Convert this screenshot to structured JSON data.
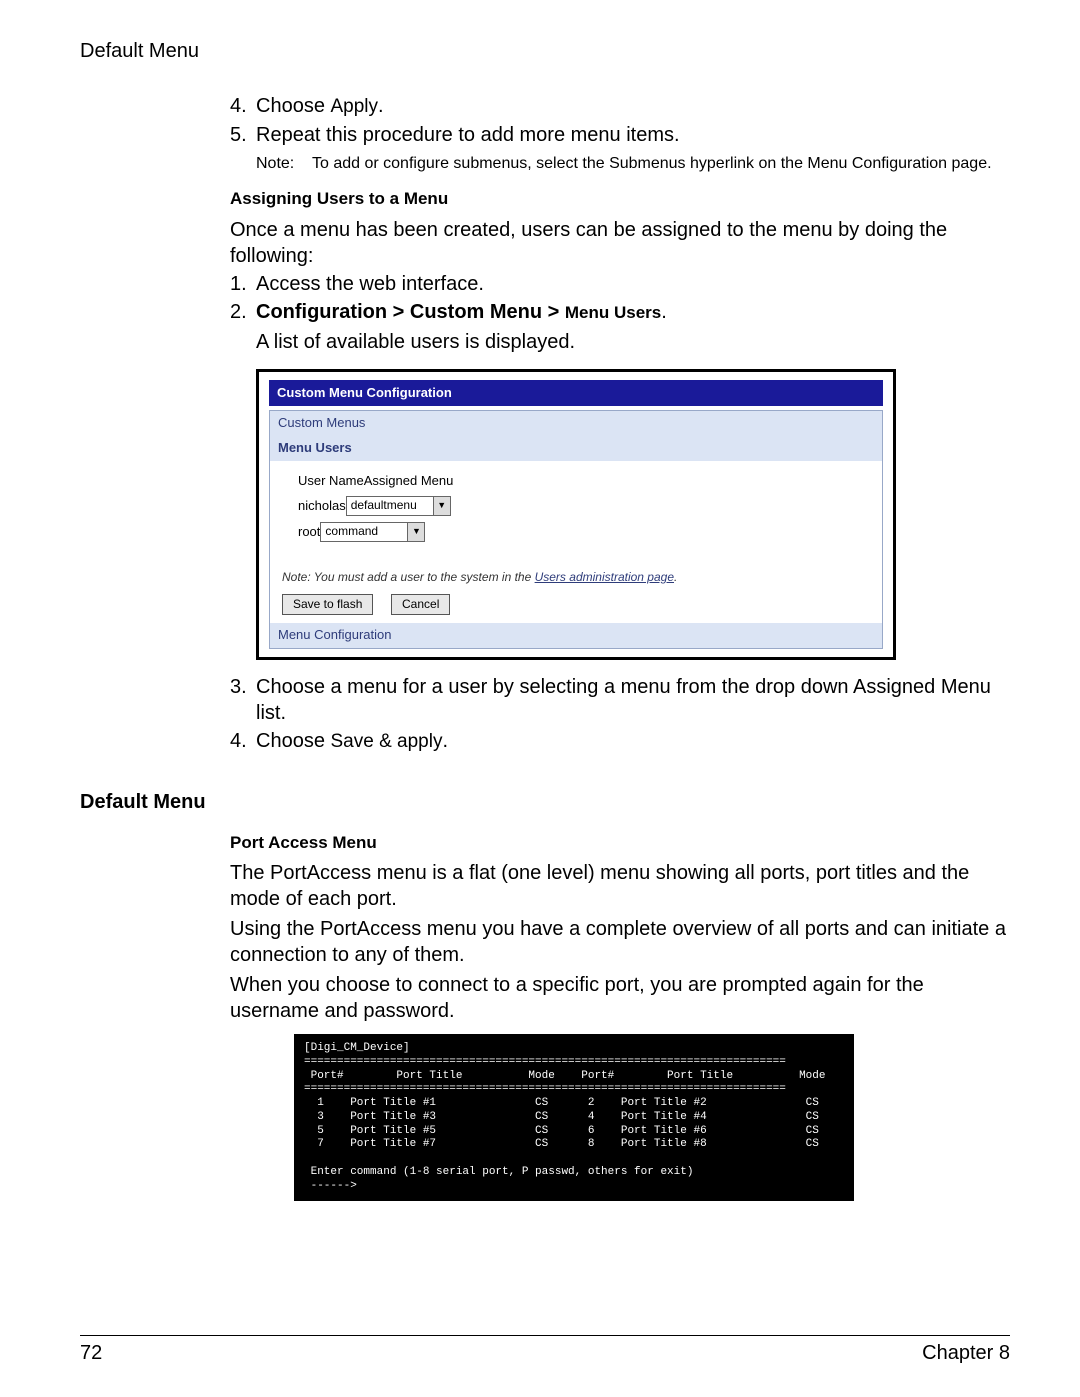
{
  "header": {
    "title": "Default Menu"
  },
  "top_steps": {
    "s4_num": "4.",
    "s4_a": "Choose ",
    "s4_b": "Apply",
    "s4_c": ".",
    "s5_num": "5.",
    "s5": "Repeat this procedure to add more menu items.",
    "note_label": "Note:",
    "note_body": "To add or configure submenus, select the Submenus hyperlink on the Menu Configuration page."
  },
  "assign": {
    "heading": "Assigning Users to a Menu",
    "intro": "Once a menu has been created, users can be assigned to the menu by doing the following:",
    "s1_num": "1.",
    "s1": "Access the web interface.",
    "s2_num": "2.",
    "s2_b": "Configuration > Custom Menu > ",
    "s2_m": "Menu Users",
    "s2_dot": ".",
    "after2": "A list of available users is displayed."
  },
  "cm": {
    "title": "Custom Menu Configuration",
    "tab_custom": "Custom Menus",
    "tab_users": "Menu Users",
    "col_user": "User Name",
    "col_menu": "Assigned Menu",
    "rows": [
      {
        "user": "nicholas",
        "menu": "defaultmenu"
      },
      {
        "user": "root",
        "menu": "command"
      }
    ],
    "note_a": "Note: You must add a user to the system in the ",
    "note_link": "Users administration page",
    "note_b": ".",
    "btn_save": "Save to flash",
    "btn_cancel": "Cancel",
    "tab_menuconf": "Menu Configuration"
  },
  "after_cm": {
    "s3_num": "3.",
    "s3": "Choose a menu for a user by selecting a menu from the drop down Assigned Menu list.",
    "s4_num": "4.",
    "s4_a": "Choose ",
    "s4_b": "Save & apply",
    "s4_c": "."
  },
  "dm": {
    "heading": "Default Menu"
  },
  "pa": {
    "heading": "Port Access Menu",
    "p1": "The PortAccess menu is a flat (one level) menu showing all ports, port titles and the mode of each port.",
    "p2": "Using the PortAccess menu you have a complete overview of all ports and can initiate a connection to any of them.",
    "p3": "When you choose to connect to a specific port, you are prompted again for the username and password."
  },
  "term": "[Digi_CM_Device]\n=========================================================================\n Port#        Port Title          Mode    Port#        Port Title          Mode\n=========================================================================\n  1    Port Title #1               CS      2    Port Title #2               CS\n  3    Port Title #3               CS      4    Port Title #4               CS\n  5    Port Title #5               CS      6    Port Title #6               CS\n  7    Port Title #7               CS      8    Port Title #8               CS\n\n Enter command (1-8 serial port, P passwd, others for exit)\n ------>",
  "footer": {
    "page": "72",
    "chapter": "Chapter 8"
  }
}
